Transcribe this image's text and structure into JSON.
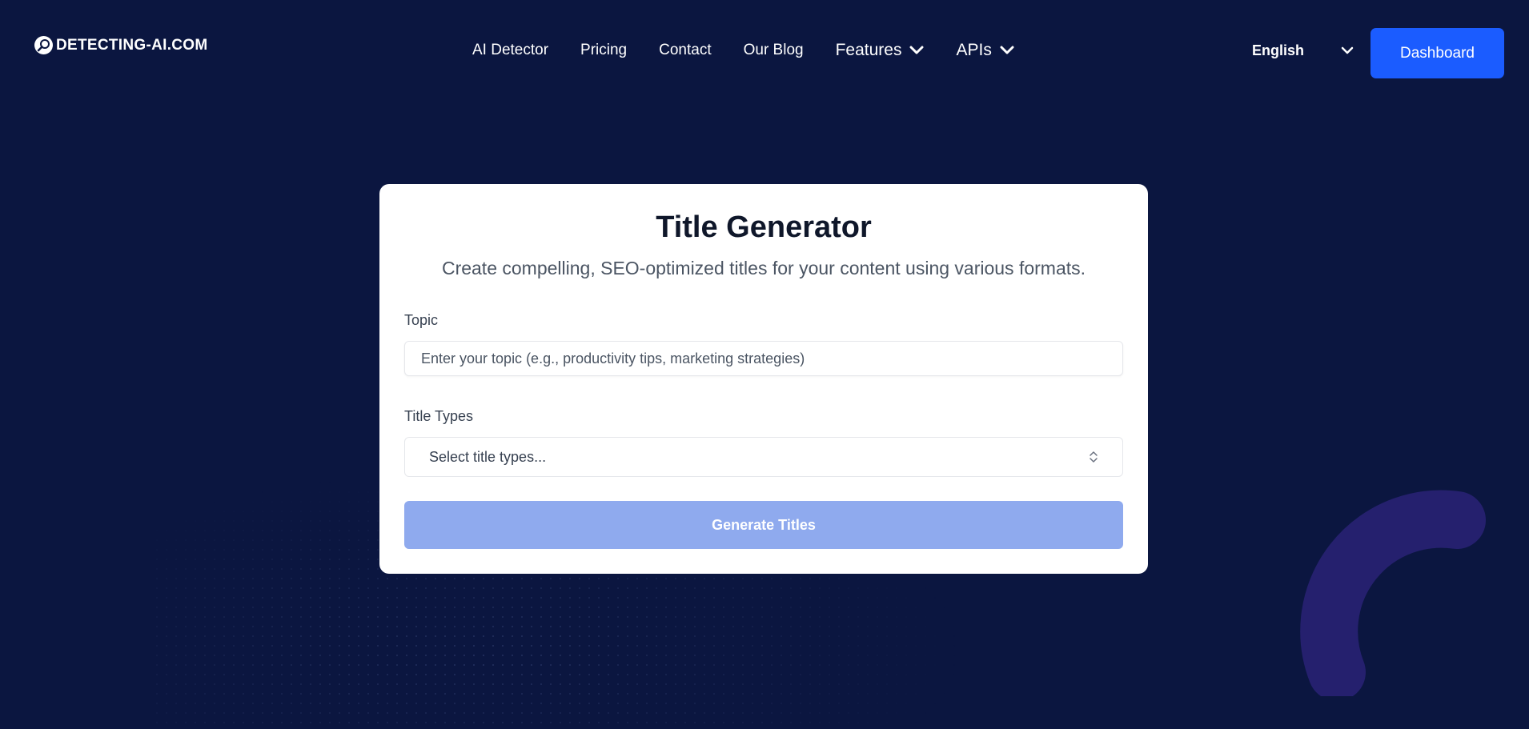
{
  "colors": {
    "background": "#0b1640",
    "accent": "#1b5cff",
    "button_disabled": "#8faaee",
    "decor_arc": "#25206e"
  },
  "logo": {
    "text": "DETECTING-AI.COM",
    "icon": "magnifier-logo-icon"
  },
  "nav": {
    "ai_detector": "AI Detector",
    "pricing": "Pricing",
    "contact": "Contact",
    "blog": "Our Blog",
    "features": "Features",
    "apis": "APIs"
  },
  "language": {
    "selected": "English"
  },
  "dashboard_label": "Dashboard",
  "card": {
    "title": "Title Generator",
    "subtitle": "Create compelling, SEO-optimized titles for your content using various formats.",
    "topic_label": "Topic",
    "topic_placeholder": "Enter your topic (e.g., productivity tips, marketing strategies)",
    "title_types_label": "Title Types",
    "title_types_placeholder": "Select title types...",
    "generate_label": "Generate Titles"
  }
}
